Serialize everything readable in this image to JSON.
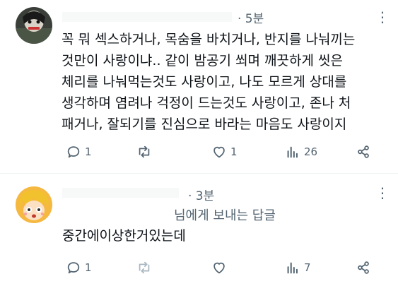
{
  "replies": [
    {
      "time": "· 5분",
      "more_glyph": "⋮",
      "lines": [
        "꼭 뭐 섹스하거나, 목숨을 바치거나, 반지를 나눠끼는",
        "것만이 사랑이냐.. 같이 밤공기 쐬며 깨끗하게 씻은",
        "체리를 나눠먹는것도 사랑이고, 나도 모르게 상대를",
        "생각하며 염려나 걱정이 드는것도 사랑이고, 존나 처",
        "패거나, 잘되기를 진심으로 바라는 마음도 사랑이지"
      ],
      "actions": {
        "replies": "1",
        "retweets": "",
        "likes": "1",
        "views": "26"
      },
      "colors": {
        "avatar_bg": "#3b3f3a"
      }
    },
    {
      "time": "· 3분",
      "more_glyph": "⋮",
      "reply_to": "님에게 보내는 답글",
      "lines": [
        "중간에이상한거있는데"
      ],
      "actions": {
        "replies": "1",
        "retweets": "",
        "likes": "",
        "views": "7"
      },
      "colors": {
        "avatar_bg": "#f5b841"
      }
    }
  ]
}
